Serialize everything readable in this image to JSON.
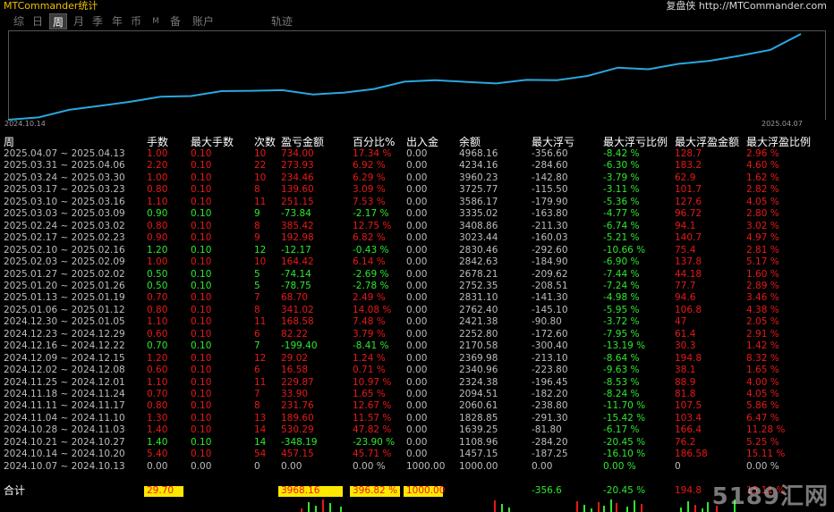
{
  "app": {
    "title": "MTCommander统计",
    "brand_link": "复盘侠 http://MTCommander.com"
  },
  "tabs": [
    {
      "label": "综",
      "active": false
    },
    {
      "label": "日",
      "active": false
    },
    {
      "label": "周",
      "active": true
    },
    {
      "label": "月",
      "active": false
    },
    {
      "label": "季",
      "active": false
    },
    {
      "label": "年",
      "active": false
    },
    {
      "label": "币",
      "active": false
    },
    {
      "label": "M",
      "active": false
    },
    {
      "label": "备",
      "active": false
    },
    {
      "label": "账户",
      "active": false
    },
    {
      "label": "轨迹",
      "active": false
    }
  ],
  "chart": {
    "start_label": "2024.10.14",
    "end_label": "2025.04.07",
    "line_color": "#2aa7e0",
    "values": [
      1000.0,
      1108.96,
      1457.15,
      1639.25,
      1828.85,
      2060.61,
      2094.51,
      2324.38,
      2340.96,
      2369.98,
      2170.58,
      2252.8,
      2421.38,
      2762.4,
      2831.1,
      2752.35,
      2678.21,
      2842.63,
      2830.46,
      3023.44,
      3408.86,
      3335.02,
      3586.17,
      3725.77,
      3960.23,
      4234.16,
      4968.16
    ]
  },
  "table": {
    "headers": [
      "周",
      "手数",
      "最大手数",
      "次数",
      "盈亏金额",
      "百分比%",
      "出入金",
      "余额",
      "最大浮亏",
      "最大浮亏比例",
      "最大浮盈金额",
      "最大浮盈比例"
    ],
    "rows": [
      [
        "2025.04.07 ~ 2025.04.13",
        "1.00",
        "0.10",
        "10",
        "734.00",
        "17.34 %",
        "0.00",
        "4968.16",
        "-356.60",
        "-8.42 %",
        "128.7",
        "2.96 %"
      ],
      [
        "2025.03.31 ~ 2025.04.06",
        "2.20",
        "0.10",
        "22",
        "273.93",
        "6.92 %",
        "0.00",
        "4234.16",
        "-284.60",
        "-6.30 %",
        "183.2",
        "4.60 %"
      ],
      [
        "2025.03.24 ~ 2025.03.30",
        "1.00",
        "0.10",
        "10",
        "234.46",
        "6.29 %",
        "0.00",
        "3960.23",
        "-142.80",
        "-3.79 %",
        "62.9",
        "1.62 %"
      ],
      [
        "2025.03.17 ~ 2025.03.23",
        "0.80",
        "0.10",
        "8",
        "139.60",
        "3.09 %",
        "0.00",
        "3725.77",
        "-115.50",
        "-3.11 %",
        "101.7",
        "2.82 %"
      ],
      [
        "2025.03.10 ~ 2025.03.16",
        "1.10",
        "0.10",
        "11",
        "251.15",
        "7.53 %",
        "0.00",
        "3586.17",
        "-179.90",
        "-5.36 %",
        "127.6",
        "4.05 %"
      ],
      [
        "2025.03.03 ~ 2025.03.09",
        "0.90",
        "0.10",
        "9",
        "-73.84",
        "-2.17 %",
        "0.00",
        "3335.02",
        "-163.80",
        "-4.77 %",
        "96.72",
        "2.80 %"
      ],
      [
        "2025.02.24 ~ 2025.03.02",
        "0.80",
        "0.10",
        "8",
        "385.42",
        "12.75 %",
        "0.00",
        "3408.86",
        "-211.30",
        "-6.74 %",
        "94.1",
        "3.02 %"
      ],
      [
        "2025.02.17 ~ 2025.02.23",
        "0.90",
        "0.10",
        "9",
        "192.98",
        "6.82 %",
        "0.00",
        "3023.44",
        "-160.03",
        "-5.21 %",
        "140.7",
        "4.97 %"
      ],
      [
        "2025.02.10 ~ 2025.02.16",
        "1.20",
        "0.10",
        "12",
        "-12.17",
        "-0.43 %",
        "0.00",
        "2830.46",
        "-292.60",
        "-10.66 %",
        "75.4",
        "2.81 %"
      ],
      [
        "2025.02.03 ~ 2025.02.09",
        "1.00",
        "0.10",
        "10",
        "164.42",
        "6.14 %",
        "0.00",
        "2842.63",
        "-184.90",
        "-6.90 %",
        "137.8",
        "5.17 %"
      ],
      [
        "2025.01.27 ~ 2025.02.02",
        "0.50",
        "0.10",
        "5",
        "-74.14",
        "-2.69 %",
        "0.00",
        "2678.21",
        "-209.62",
        "-7.44 %",
        "44.18",
        "1.60 %"
      ],
      [
        "2025.01.20 ~ 2025.01.26",
        "0.50",
        "0.10",
        "5",
        "-78.75",
        "-2.78 %",
        "0.00",
        "2752.35",
        "-208.51",
        "-7.24 %",
        "77.7",
        "2.89 %"
      ],
      [
        "2025.01.13 ~ 2025.01.19",
        "0.70",
        "0.10",
        "7",
        "68.70",
        "2.49 %",
        "0.00",
        "2831.10",
        "-141.30",
        "-4.98 %",
        "94.6",
        "3.46 %"
      ],
      [
        "2025.01.06 ~ 2025.01.12",
        "0.80",
        "0.10",
        "8",
        "341.02",
        "14.08 %",
        "0.00",
        "2762.40",
        "-145.10",
        "-5.95 %",
        "106.8",
        "4.38 %"
      ],
      [
        "2024.12.30 ~ 2025.01.05",
        "1.10",
        "0.10",
        "11",
        "168.58",
        "7.48 %",
        "0.00",
        "2421.38",
        "-90.80",
        "-3.72 %",
        "47",
        "2.05 %"
      ],
      [
        "2024.12.23 ~ 2024.12.29",
        "0.60",
        "0.10",
        "6",
        "82.22",
        "3.79 %",
        "0.00",
        "2252.80",
        "-172.60",
        "-7.95 %",
        "61.4",
        "2.91 %"
      ],
      [
        "2024.12.16 ~ 2024.12.22",
        "0.70",
        "0.10",
        "7",
        "-199.40",
        "-8.41 %",
        "0.00",
        "2170.58",
        "-300.40",
        "-13.19 %",
        "30.3",
        "1.42 %"
      ],
      [
        "2024.12.09 ~ 2024.12.15",
        "1.20",
        "0.10",
        "12",
        "29.02",
        "1.24 %",
        "0.00",
        "2369.98",
        "-213.10",
        "-8.64 %",
        "194.8",
        "8.32 %"
      ],
      [
        "2024.12.02 ~ 2024.12.08",
        "0.60",
        "0.10",
        "6",
        "16.58",
        "0.71 %",
        "0.00",
        "2340.96",
        "-223.80",
        "-9.63 %",
        "38.1",
        "1.65 %"
      ],
      [
        "2024.11.25 ~ 2024.12.01",
        "1.10",
        "0.10",
        "11",
        "229.87",
        "10.97 %",
        "0.00",
        "2324.38",
        "-196.45",
        "-8.53 %",
        "88.9",
        "4.00 %"
      ],
      [
        "2024.11.18 ~ 2024.11.24",
        "0.70",
        "0.10",
        "7",
        "33.90",
        "1.65 %",
        "0.00",
        "2094.51",
        "-182.20",
        "-8.24 %",
        "81.8",
        "4.05 %"
      ],
      [
        "2024.11.11 ~ 2024.11.17",
        "0.80",
        "0.10",
        "8",
        "231.76",
        "12.67 %",
        "0.00",
        "2060.61",
        "-238.80",
        "-11.70 %",
        "107.5",
        "5.86 %"
      ],
      [
        "2024.11.04 ~ 2024.11.10",
        "1.30",
        "0.10",
        "13",
        "189.60",
        "11.57 %",
        "0.00",
        "1828.85",
        "-291.30",
        "-15.42 %",
        "103.4",
        "6.47 %"
      ],
      [
        "2024.10.28 ~ 2024.11.03",
        "1.40",
        "0.10",
        "14",
        "530.29",
        "47.82 %",
        "0.00",
        "1639.25",
        "-81.80",
        "-6.17 %",
        "166.4",
        "11.28 %"
      ],
      [
        "2024.10.21 ~ 2024.10.27",
        "1.40",
        "0.10",
        "14",
        "-348.19",
        "-23.90 %",
        "0.00",
        "1108.96",
        "-284.20",
        "-20.45 %",
        "76.2",
        "5.25 %"
      ],
      [
        "2024.10.14 ~ 2024.10.20",
        "5.40",
        "0.10",
        "54",
        "457.15",
        "45.71 %",
        "0.00",
        "1457.15",
        "-187.25",
        "-16.10 %",
        "186.58",
        "15.11 %"
      ],
      [
        "2024.10.07 ~ 2024.10.13",
        "0.00",
        "0.00",
        "0",
        "0.00",
        "0.00 %",
        "1000.00",
        "1000.00",
        "0.00",
        "0.00 %",
        "0",
        "0.00 %"
      ]
    ],
    "total": [
      "合计",
      "29.70",
      "",
      "",
      "3968.16",
      "396.82 %",
      "1000.00",
      "",
      "-356.6",
      "-20.45 %",
      "194.8",
      "15.11 %"
    ]
  },
  "colors": {
    "positive": "#e81818",
    "negative": "#2ee82e",
    "neutral": "#bdbdbd",
    "header": "#ffffff",
    "highlight": "#ffe800"
  },
  "watermark": "5189汇网"
}
